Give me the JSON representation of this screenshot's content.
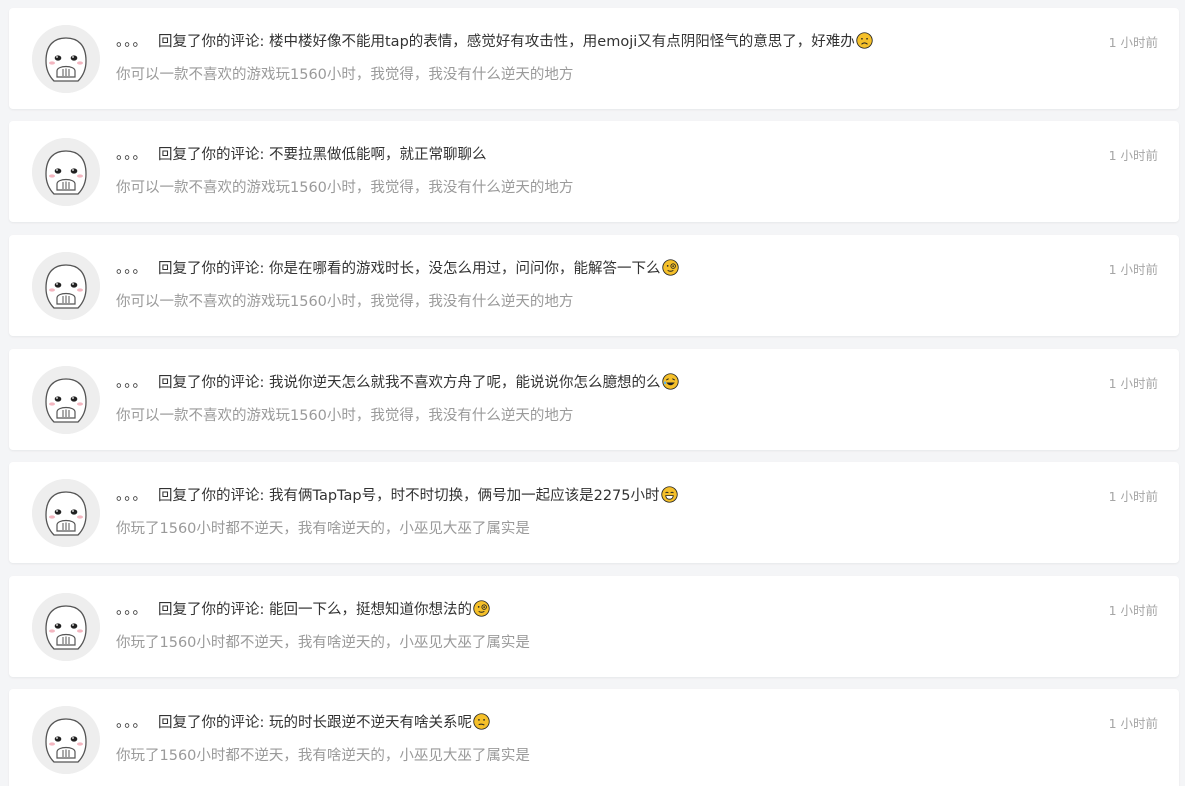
{
  "notifications": [
    {
      "nickname": "。。。",
      "action": "回复了你的评论: ",
      "reply_text": "楼中楼好像不能用tap的表情，感觉好有攻击性，用emoji又有点阴阳怪气的意思了，好难办",
      "emoji": "sad-face-emoji",
      "original_comment": "你可以一款不喜欢的游戏玩1560小时，我觉得，我没有什么逆天的地方",
      "time": "1 小时前"
    },
    {
      "nickname": "。。。",
      "action": "回复了你的评论: ",
      "reply_text": "不要拉黑做低能啊，就正常聊聊么",
      "emoji": "",
      "original_comment": "你可以一款不喜欢的游戏玩1560小时，我觉得，我没有什么逆天的地方",
      "time": "1 小时前"
    },
    {
      "nickname": "。。。",
      "action": "回复了你的评论: ",
      "reply_text": "你是在哪看的游戏时长，没怎么用过，问问你，能解答一下么",
      "emoji": "monocle-face-emoji",
      "original_comment": "你可以一款不喜欢的游戏玩1560小时，我觉得，我没有什么逆天的地方",
      "time": "1 小时前"
    },
    {
      "nickname": "。。。",
      "action": "回复了你的评论: ",
      "reply_text": "我说你逆天怎么就我不喜欢方舟了呢，能说说你怎么臆想的么",
      "emoji": "rofl-face-emoji",
      "original_comment": "你可以一款不喜欢的游戏玩1560小时，我觉得，我没有什么逆天的地方",
      "time": "1 小时前"
    },
    {
      "nickname": "。。。",
      "action": "回复了你的评论: ",
      "reply_text": "我有俩TapTap号，时不时切换，俩号加一起应该是2275小时",
      "emoji": "grin-face-emoji",
      "original_comment": "你玩了1560小时都不逆天，我有啥逆天的，小巫见大巫了属实是",
      "time": "1 小时前"
    },
    {
      "nickname": "。。。",
      "action": "回复了你的评论: ",
      "reply_text": "能回一下么，挺想知道你想法的",
      "emoji": "monocle-face-emoji",
      "original_comment": "你玩了1560小时都不逆天，我有啥逆天的，小巫见大巫了属实是",
      "time": "1 小时前"
    },
    {
      "nickname": "。。。",
      "action": "回复了你的评论: ",
      "reply_text": "玩的时长跟逆不逆天有啥关系呢",
      "emoji": "confused-face-emoji",
      "original_comment": "你玩了1560小时都不逆天，我有啥逆天的，小巫见大巫了属实是",
      "time": "1 小时前"
    }
  ],
  "colors": {
    "page_background": "#f4f5f7",
    "card_background": "#ffffff",
    "primary_text": "#333333",
    "secondary_text": "#9a9a9a",
    "time_text": "#a6a6a6",
    "emoji_yellow": "#f5c02a"
  }
}
